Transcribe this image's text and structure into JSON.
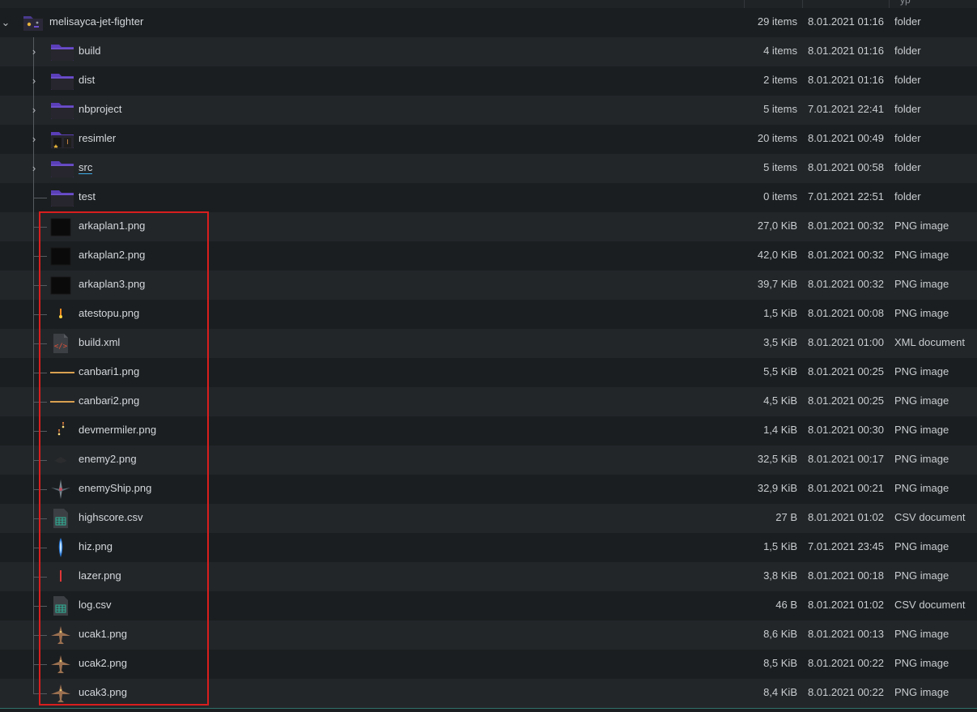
{
  "header": {
    "col_type_fragment": "yp"
  },
  "root": {
    "name": "melisayca-jet-fighter",
    "size": "29 items",
    "date": "8.01.2021 01:16",
    "type": "folder",
    "icon": "folder-special-icon"
  },
  "entries": [
    {
      "name": "build",
      "size": "4 items",
      "date": "8.01.2021 01:16",
      "type": "folder",
      "icon": "folder-icon",
      "expandable": true
    },
    {
      "name": "dist",
      "size": "2 items",
      "date": "8.01.2021 01:16",
      "type": "folder",
      "icon": "folder-icon",
      "expandable": true
    },
    {
      "name": "nbproject",
      "size": "5 items",
      "date": "7.01.2021 22:41",
      "type": "folder",
      "icon": "folder-icon",
      "expandable": true
    },
    {
      "name": "resimler",
      "size": "20 items",
      "date": "8.01.2021 00:49",
      "type": "folder",
      "icon": "folder-images-icon",
      "expandable": true
    },
    {
      "name": "src",
      "size": "5 items",
      "date": "8.01.2021 00:58",
      "type": "folder",
      "icon": "folder-icon",
      "expandable": true
    },
    {
      "name": "test",
      "size": "0 items",
      "date": "7.01.2021 22:51",
      "type": "folder",
      "icon": "folder-icon",
      "expandable": false
    },
    {
      "name": "arkaplan1.png",
      "size": "27,0 KiB",
      "date": "8.01.2021 00:32",
      "type": "PNG image",
      "icon": "dark-background-thumbnail-icon"
    },
    {
      "name": "arkaplan2.png",
      "size": "42,0 KiB",
      "date": "8.01.2021 00:32",
      "type": "PNG image",
      "icon": "dark-background-thumbnail-icon"
    },
    {
      "name": "arkaplan3.png",
      "size": "39,7 KiB",
      "date": "8.01.2021 00:32",
      "type": "PNG image",
      "icon": "dark-background-thumbnail-icon"
    },
    {
      "name": "atestopu.png",
      "size": "1,5 KiB",
      "date": "8.01.2021 00:08",
      "type": "PNG image",
      "icon": "fireball-thumbnail-icon"
    },
    {
      "name": "build.xml",
      "size": "3,5 KiB",
      "date": "8.01.2021 01:00",
      "type": "XML document",
      "icon": "xml-file-icon"
    },
    {
      "name": "canbari1.png",
      "size": "5,5 KiB",
      "date": "8.01.2021 00:25",
      "type": "PNG image",
      "icon": "health-bar-thumbnail-icon"
    },
    {
      "name": "canbari2.png",
      "size": "4,5 KiB",
      "date": "8.01.2021 00:25",
      "type": "PNG image",
      "icon": "health-bar-thumbnail-icon"
    },
    {
      "name": "devmermiler.png",
      "size": "1,4 KiB",
      "date": "8.01.2021 00:30",
      "type": "PNG image",
      "icon": "bullet-thumbnail-icon"
    },
    {
      "name": "enemy2.png",
      "size": "32,5 KiB",
      "date": "8.01.2021 00:17",
      "type": "PNG image",
      "icon": "enemy-thumbnail-icon"
    },
    {
      "name": "enemyShip.png",
      "size": "32,9 KiB",
      "date": "8.01.2021 00:21",
      "type": "PNG image",
      "icon": "enemy-ship-thumbnail-icon"
    },
    {
      "name": "highscore.csv",
      "size": "27 B",
      "date": "8.01.2021 01:02",
      "type": "CSV document",
      "icon": "spreadsheet-file-icon"
    },
    {
      "name": "hiz.png",
      "size": "1,5 KiB",
      "date": "7.01.2021 23:45",
      "type": "PNG image",
      "icon": "speed-boost-thumbnail-icon"
    },
    {
      "name": "lazer.png",
      "size": "3,8 KiB",
      "date": "8.01.2021 00:18",
      "type": "PNG image",
      "icon": "laser-thumbnail-icon"
    },
    {
      "name": "log.csv",
      "size": "46 B",
      "date": "8.01.2021 01:02",
      "type": "CSV document",
      "icon": "spreadsheet-file-icon"
    },
    {
      "name": "ucak1.png",
      "size": "8,6 KiB",
      "date": "8.01.2021 00:13",
      "type": "PNG image",
      "icon": "plane-thumbnail-icon"
    },
    {
      "name": "ucak2.png",
      "size": "8,5 KiB",
      "date": "8.01.2021 00:22",
      "type": "PNG image",
      "icon": "plane-thumbnail-icon"
    },
    {
      "name": "ucak3.png",
      "size": "8,4 KiB",
      "date": "8.01.2021 00:22",
      "type": "PNG image",
      "icon": "plane-thumbnail-icon"
    }
  ],
  "colors": {
    "background": "#1b1e20",
    "row_alt": "#232629",
    "text": "#c9cdd0",
    "folder": "#6b4fc8",
    "highlight_box": "#d91e1e",
    "accent": "#3daee9"
  }
}
